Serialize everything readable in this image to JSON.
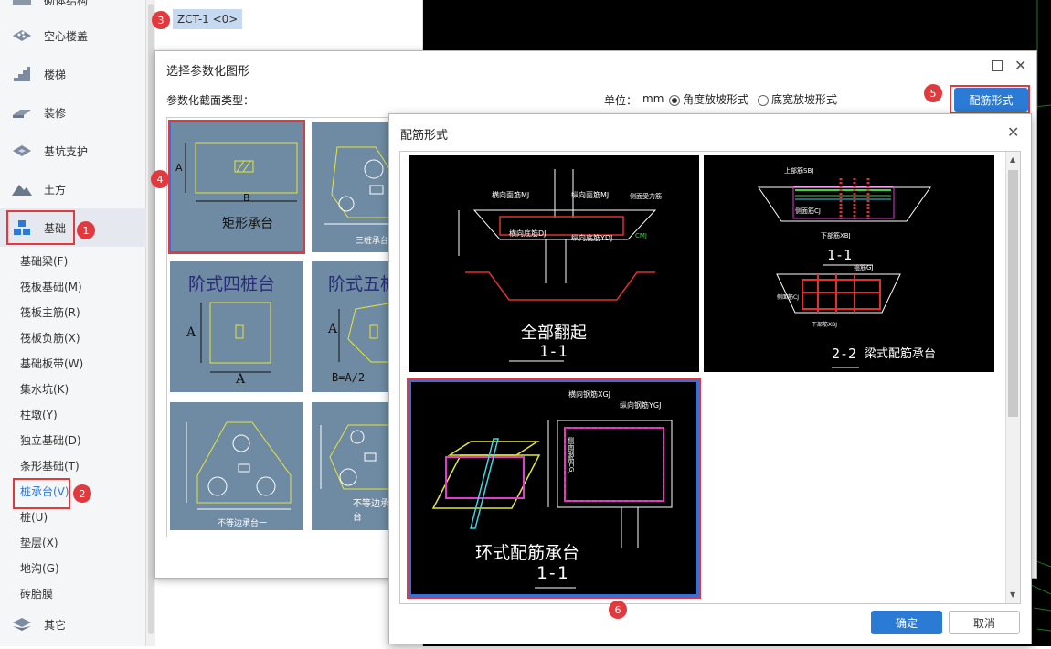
{
  "sidebar": {
    "categories": [
      {
        "label": "砌体结构",
        "icon": "wall-icon"
      },
      {
        "label": "空心楼盖",
        "icon": "hollow-slab-icon"
      },
      {
        "label": "楼梯",
        "icon": "stairs-icon"
      },
      {
        "label": "装修",
        "icon": "decoration-icon"
      },
      {
        "label": "基坑支护",
        "icon": "pit-support-icon"
      },
      {
        "label": "土方",
        "icon": "earthwork-icon"
      },
      {
        "label": "基础",
        "icon": "foundation-icon"
      }
    ],
    "sub_items": [
      "基础梁(F)",
      "筏板基础(M)",
      "筏板主筋(R)",
      "筏板负筋(X)",
      "基础板带(W)",
      "集水坑(K)",
      "柱墩(Y)",
      "独立基础(D)",
      "条形基础(T)",
      "桩承台(V)",
      "桩(U)",
      "垫层(X)",
      "地沟(G)",
      "砖胎膜"
    ],
    "other": {
      "label": "其它",
      "icon": "other-icon"
    }
  },
  "annotations": {
    "n1": "1",
    "n2": "2",
    "n3": "3",
    "n4": "4",
    "n5": "5",
    "n6": "6"
  },
  "element_tag": "ZCT-1 <0>",
  "dialog_param": {
    "title": "选择参数化图形",
    "section_label": "参数化截面类型：",
    "unit_label": "单位：",
    "unit_value": "mm",
    "radio_angle": "角度放坡形式",
    "radio_width": "底宽放坡形式",
    "rebar_button": "配筋形式",
    "tiles": [
      {
        "title": "矩形承台",
        "dim_a": "A",
        "dim_b": "B"
      },
      {
        "title": "三桩承台"
      },
      {
        "title": "阶式四桩台",
        "dim_a": "A",
        "dim_b": "A"
      },
      {
        "title": "阶式五桩台",
        "dim_a": "A",
        "dim_b": "B=A/2"
      },
      {
        "title": "不等边承台一"
      },
      {
        "title": "不等边承台"
      }
    ]
  },
  "dialog_rebar": {
    "title": "配筋形式",
    "ok": "确定",
    "cancel": "取消",
    "pic1": {
      "caption": "全部翻起",
      "section": "1-1",
      "labels": [
        "横向面筋MJ",
        "纵向面筋MJ",
        "横向底筋DJ",
        "纵向底筋YDJ",
        "侧面受力筋",
        "CMJ"
      ]
    },
    "pic2": {
      "caption": "梁式配筋承台",
      "section_a": "1-1",
      "section_b": "2-2",
      "labels": [
        "上部筋SBJ",
        "侧面筋CJ",
        "下部筋XBJ",
        "箍筋GJ",
        "侧面筋CJ",
        "下部筋XBJ"
      ]
    },
    "pic3": {
      "caption": "环式配筋承台",
      "section": "1-1",
      "labels": [
        "横向钢筋XGJ",
        "纵向钢筋YGJ",
        "侧面钢筋CGJ"
      ]
    }
  },
  "colors": {
    "accent": "#2b7ad4",
    "marker": "#e0393e",
    "tile": "#6f8ba3"
  }
}
